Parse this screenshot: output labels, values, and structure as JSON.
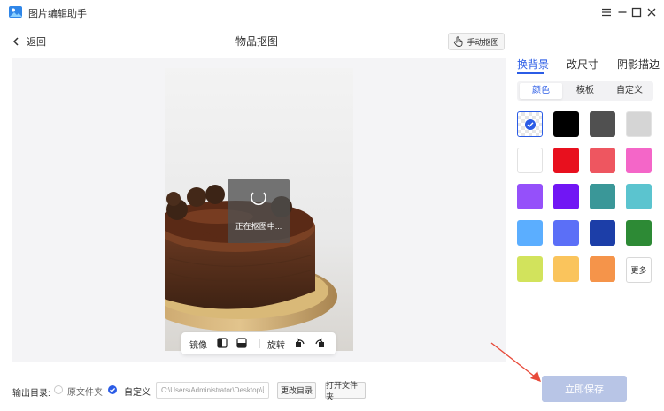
{
  "app": {
    "title": "图片编辑助手",
    "logo_icon": "app-logo-icon",
    "window_controls": [
      "menu-icon",
      "minimize-icon",
      "maximize-icon",
      "close-icon"
    ]
  },
  "header": {
    "back_label": "返回",
    "page_title": "物品抠图",
    "manual_button_label": "手动抠图"
  },
  "canvas": {
    "processing_text": "正在抠图中...",
    "toolbar": {
      "mirror_label": "镜像",
      "rotate_label": "旋转",
      "icons": [
        "mirror-horizontal-icon",
        "mirror-vertical-icon",
        "rotate-left-icon",
        "rotate-right-icon"
      ]
    }
  },
  "panel": {
    "tabs": [
      {
        "label": "换背景",
        "active": true
      },
      {
        "label": "改尺寸",
        "active": false
      },
      {
        "label": "阴影描边",
        "active": false
      }
    ],
    "segments": [
      {
        "label": "颜色",
        "active": true
      },
      {
        "label": "模板",
        "active": false
      },
      {
        "label": "自定义",
        "active": false
      }
    ],
    "swatches": [
      "transparent",
      "#000000",
      "#505050",
      "#d5d5d5",
      "#ffffff",
      "#e8101e",
      "#ee5660",
      "#f466c8",
      "#9550fa",
      "#7116f4",
      "#3a9798",
      "#5bc4cf",
      "#5baeff",
      "#5b6ff7",
      "#1c3ea8",
      "#2d8a35",
      "#d2e35c",
      "#fac45c",
      "#f5944a"
    ],
    "more_label": "更多"
  },
  "bottom": {
    "output_label": "输出目录:",
    "option_original": "原文件夹",
    "option_custom": "自定义",
    "path_value": "C:\\Users\\Administrator\\Desktop\\图",
    "change_dir_label": "更改目录",
    "open_folder_label": "打开文件夹",
    "save_label": "立即保存"
  },
  "colors": {
    "accent": "#2b5ce6",
    "save_button": "#b8c5e6",
    "arrow": "#e84a3a"
  }
}
